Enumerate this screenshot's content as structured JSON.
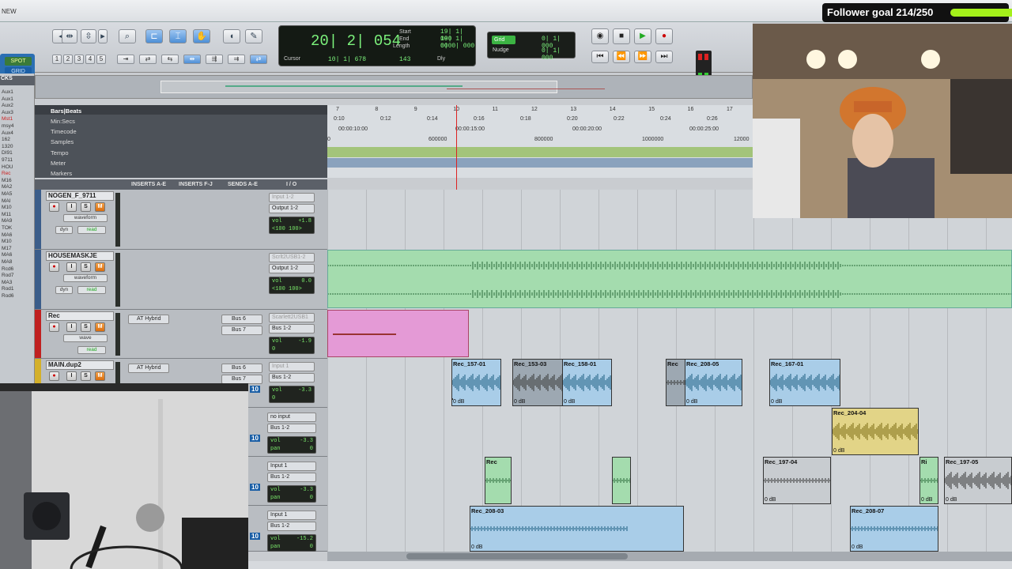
{
  "window": {
    "title_fragment": "NEW"
  },
  "modes": {
    "spot": "SPOT",
    "grid": "GRID"
  },
  "counter": {
    "main": "20| 2| 054",
    "start_label": "Start",
    "end_label": "End",
    "length_label": "Length",
    "start": "19| 1| 000",
    "end": "19| 1| 000",
    "length": "0| 0| 000",
    "cursor_label": "Cursor",
    "cursor": "10| 1| 678",
    "cursor_extra": "143",
    "dly": "Dly"
  },
  "grid": {
    "grid_label": "Grid",
    "grid_value": "0| 1| 000",
    "nudge_label": "Nudge",
    "nudge_value": "0| 1| 000"
  },
  "tracklist": {
    "header": "CKS",
    "items": [
      "Aux1",
      "Aux1",
      "Aux2",
      "Aux3",
      "Mst1",
      "msy4",
      "Aux4",
      "162",
      "1320",
      "DI91",
      "9711",
      "HOU",
      "Rec",
      "M16",
      "MA2",
      "MA5",
      "MAI",
      "M10",
      "M11",
      "MA9",
      "TOK",
      "MA6",
      "M10",
      "M17",
      "MA6",
      "MA8",
      "Rcd6",
      "Rod7",
      "MA3",
      "Rod1",
      "Rod6"
    ]
  },
  "ruler": {
    "rows": [
      "Bars|Beats",
      "Min:Secs",
      "Timecode",
      "Samples",
      "Tempo",
      "Meter",
      "Markers"
    ],
    "bars": [
      "7",
      "8",
      "9",
      "10",
      "11",
      "12",
      "13",
      "14",
      "15",
      "16",
      "17"
    ],
    "minsecs": [
      "0:10",
      "0:12",
      "0:14",
      "0:16",
      "0:18",
      "0:20",
      "0:22",
      "0:24",
      "0:26"
    ],
    "timecode": [
      "00:00:10:00",
      "00:00:15:00",
      "00:00:20:00",
      "00:00:25:00"
    ],
    "samples": [
      "600000",
      "800000",
      "1000000",
      "12000",
      "0"
    ]
  },
  "columns": {
    "inserts_ae": "INSERTS A-E",
    "inserts_fj": "INSERTS F-J",
    "sends_ae": "SENDS A-E",
    "io": "I / O"
  },
  "tracks": [
    {
      "name": "NOGEN_F_9711",
      "input": "Input 1-2",
      "output": "Output 1-2",
      "view": "waveform",
      "dyn": "dyn",
      "read": "read",
      "vol": "+1.8",
      "pan": "<100  100>"
    },
    {
      "name": "HOUSEMASKJE",
      "input": "Scrlt2USB1-2",
      "output": "Output 1-2",
      "view": "waveform",
      "dyn": "dyn",
      "read": "read",
      "vol": "0.0",
      "pan": "<100  100>"
    },
    {
      "name": "Rec",
      "insert": "AT Hybrid",
      "send1": "Bus 6",
      "send2": "Bus 7",
      "input": "Scarlett2USB1",
      "output": "Bus 1-2",
      "view": "wave",
      "read": "read",
      "vol": "-1.9",
      "pan": "0"
    },
    {
      "name": "MAIN.dup2",
      "insert": "AT Hybrid",
      "send1": "Bus 6",
      "send2": "Bus 7",
      "input": "Input 1",
      "output": "Bus 1-2",
      "vol": "-3.3",
      "pan": "0"
    },
    {
      "input": "no input",
      "output": "Bus 1-2",
      "vol": "-3.3",
      "pan": "0"
    },
    {
      "input": "Input 1",
      "output": "Bus 1-2",
      "vol": "-3.3",
      "pan": "0"
    },
    {
      "input": "Input 1",
      "output": "Bus 1-2",
      "vol": "-15.2",
      "pan": "0"
    }
  ],
  "lane_numbers": [
    "10",
    "10",
    "10",
    "10"
  ],
  "clips": [
    {
      "name": "Rec_157-01",
      "db": "0 dB"
    },
    {
      "name": "Rec_153-03",
      "db": "0 dB"
    },
    {
      "name": "Rec_158-01",
      "db": "0 dB"
    },
    {
      "name": "Rec",
      "db": ""
    },
    {
      "name": "Rec_208-05",
      "db": "0 dB"
    },
    {
      "name": "Rec_167-01",
      "db": "0 dB"
    },
    {
      "name": "Rec_204-04",
      "db": "0 dB"
    },
    {
      "name": "Rec",
      "db": ""
    },
    {
      "name": "Rec_197-04",
      "db": "0 dB"
    },
    {
      "name": "Ri",
      "db": "0 dB"
    },
    {
      "name": "Rec_197-05",
      "db": "0 dB"
    },
    {
      "name": "Rec_208-03",
      "db": "0 dB"
    },
    {
      "name": "Rec_208-07",
      "db": "0 dB"
    },
    {
      "name": "0 dB",
      "db": ""
    },
    {
      "name": "0 dB",
      "db": ""
    }
  ],
  "overlay": {
    "goal_text": "Follower goal 214/250",
    "goal_fraction": 0.856
  },
  "colors": {
    "green_clip": "#a4dcae",
    "pink_clip": "#e49ad6",
    "blue_clip": "#a9cde8",
    "yellow_clip": "#e2d487",
    "counter_green": "#7cf27c"
  }
}
